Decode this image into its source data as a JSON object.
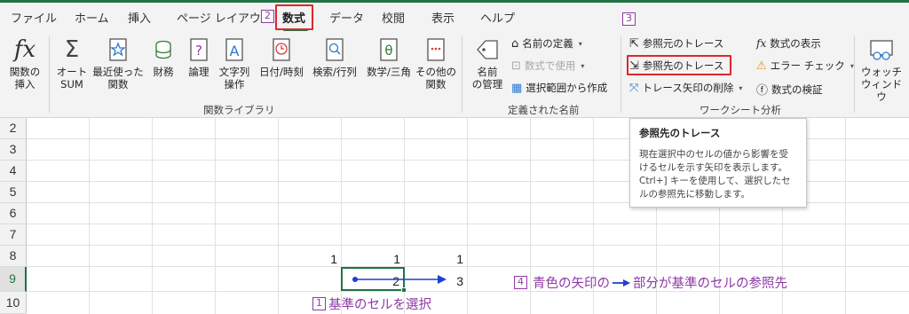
{
  "tabs": [
    "ファイル",
    "ホーム",
    "挿入",
    "ページ レイアウト",
    "数式",
    "データ",
    "校閲",
    "表示",
    "ヘルプ"
  ],
  "ribbon": {
    "function_library": {
      "insert_function": "関数の\n挿入",
      "autosum": "オート\nSUM",
      "recent": "最近使った\n関数",
      "financial": "財務",
      "logical": "論理",
      "text": "文字列\n操作",
      "datetime": "日付/時刻",
      "lookup": "検索/行列",
      "math": "数学/三角",
      "more": "その他の\n関数",
      "group_label": "関数ライブラリ"
    },
    "defined_names": {
      "name_manager": "名前\nの管理",
      "define_name": "名前の定義",
      "use_in_formula": "数式で使用",
      "create_from_selection": "選択範囲から作成",
      "group_label": "定義された名前"
    },
    "formula_auditing": {
      "trace_precedents": "参照元のトレース",
      "trace_dependents": "参照先のトレース",
      "remove_arrows": "トレース矢印の削除",
      "show_formulas": "数式の表示",
      "error_checking": "エラー チェック",
      "evaluate_formula": "数式の検証",
      "group_label": "ワークシート分析"
    },
    "watch_window": "ウォッチ\nウィンドウ"
  },
  "rows": [
    "2",
    "3",
    "4",
    "5",
    "6",
    "7",
    "8",
    "9",
    "10"
  ],
  "cells": {
    "r8": [
      "1",
      "1",
      "1"
    ],
    "r9": [
      "2",
      "3"
    ]
  },
  "tooltip": {
    "title": "参照先のトレース",
    "body": "現在選択中のセルの値から影響を受けるセルを示す矢印を表示します。Ctrl+] キーを使用して、選択したセルの参照先に移動します。"
  },
  "annotations": {
    "n1": "1",
    "t1": "基準のセルを選択",
    "n2": "2",
    "n3": "3",
    "n4": "4",
    "t4a": "青色の矢印の",
    "t4b": "部分が基準のセルの参照先"
  },
  "colors": {
    "accent": "#217346",
    "highlight": "#e0262b",
    "annotation": "#8e3aa6",
    "arrow": "#1f3fd1"
  }
}
